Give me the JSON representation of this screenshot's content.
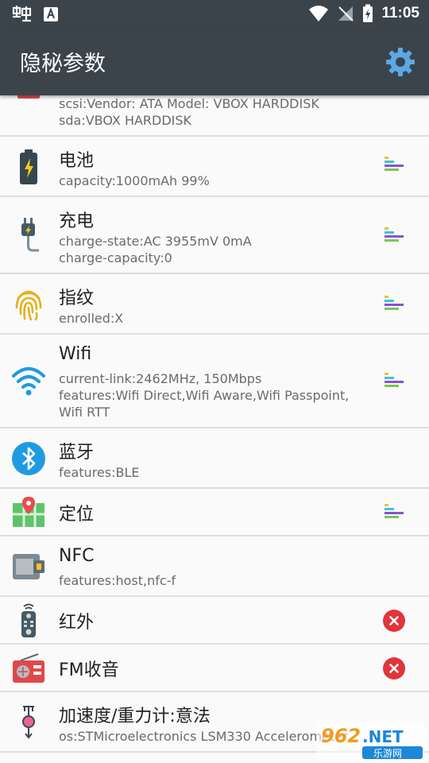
{
  "status": {
    "time": "11:05"
  },
  "app": {
    "title": "隐秘参数"
  },
  "colors": {
    "toolbar": "#3b444b",
    "error": "#e0353a",
    "accent_teal": "#3ec4d6",
    "accent_purple": "#8a4fd9",
    "accent_green": "#78c850",
    "accent_yellow": "#e6c23a"
  },
  "rows": [
    {
      "title": "",
      "lines": [
        "scsi:Vendor: ATA     Model: VBOX HARDDISK",
        "sda:VBOX HARDDISK"
      ]
    },
    {
      "title": "电池",
      "icon": "battery-icon",
      "lines": [
        "capacity:1000mAh 99%"
      ],
      "action": "detail-bars-icon"
    },
    {
      "title": "充电",
      "icon": "charger-plug-icon",
      "lines": [
        "charge-state:AC 3955mV 0mA",
        "charge-capacity:0"
      ],
      "action": "detail-bars-icon"
    },
    {
      "title": "指纹",
      "icon": "fingerprint-icon",
      "lines": [
        "enrolled:X"
      ],
      "action": "detail-bars-icon"
    },
    {
      "title": "Wifi",
      "icon": "wifi-icon",
      "lines": [
        "current-link:2462MHz, 150Mbps",
        "features:Wifi Direct,Wifi Aware,Wifi Passpoint,",
        "Wifi RTT"
      ],
      "action": "detail-bars-icon"
    },
    {
      "title": "蓝牙",
      "icon": "bluetooth-icon",
      "lines": [
        "features:BLE"
      ]
    },
    {
      "title": "定位",
      "icon": "map-location-icon",
      "lines": [],
      "action": "detail-bars-icon"
    },
    {
      "title": "NFC",
      "icon": "nfc-card-icon",
      "lines": [
        "features:host,nfc-f"
      ]
    },
    {
      "title": "红外",
      "icon": "remote-control-icon",
      "lines": [],
      "action": "unsupported-icon"
    },
    {
      "title": "FM收音",
      "icon": "radio-icon",
      "lines": [],
      "action": "unsupported-icon"
    },
    {
      "title": "加速度/重力计:意法",
      "icon": "accelerometer-icon",
      "lines": [
        "os:STMicroelectronics LSM330 Accelerometer"
      ]
    }
  ],
  "watermark": {
    "brand": "962.NET",
    "sub": "乐游网"
  }
}
